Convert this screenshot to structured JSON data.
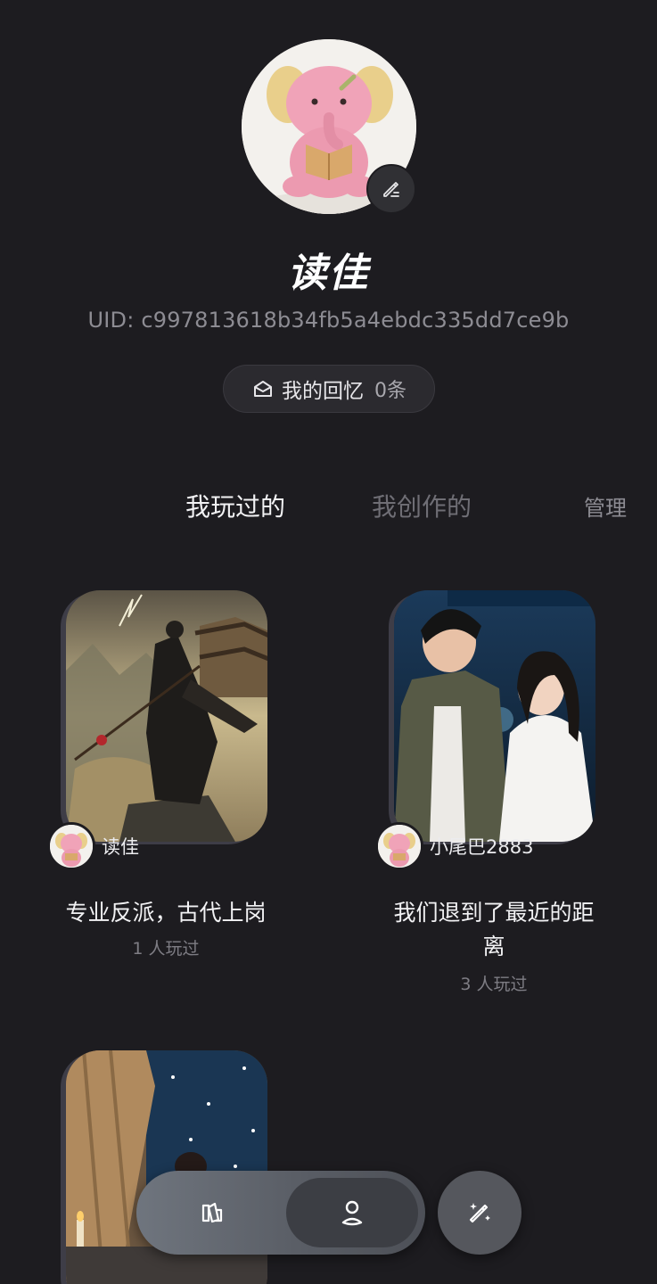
{
  "profile": {
    "name": "读佳",
    "uid": "UID: c997813618b34fb5a4ebdc335dd7ce9b",
    "memories_label": "我的回忆",
    "memories_count": "0条"
  },
  "tabs": {
    "played": "我玩过的",
    "created": "我创作的",
    "manage": "管理"
  },
  "cards": [
    {
      "author": "读佳",
      "title": "专业反派，古代上岗",
      "plays": "1 人玩过"
    },
    {
      "author": "小尾巴2883",
      "title_line1": "我们退到了最近的距",
      "title_line2": "离",
      "plays": "3 人玩过"
    },
    {
      "author": ""
    }
  ],
  "nav": {
    "items": [
      "library-icon",
      "profile-icon",
      "create-icon"
    ],
    "active": "profile-icon"
  },
  "colors": {
    "background": "#1d1c20",
    "muted_text": "#8d8c93",
    "nav_gradient_start": "#6f757e",
    "nav_active": "#3c3e44"
  }
}
